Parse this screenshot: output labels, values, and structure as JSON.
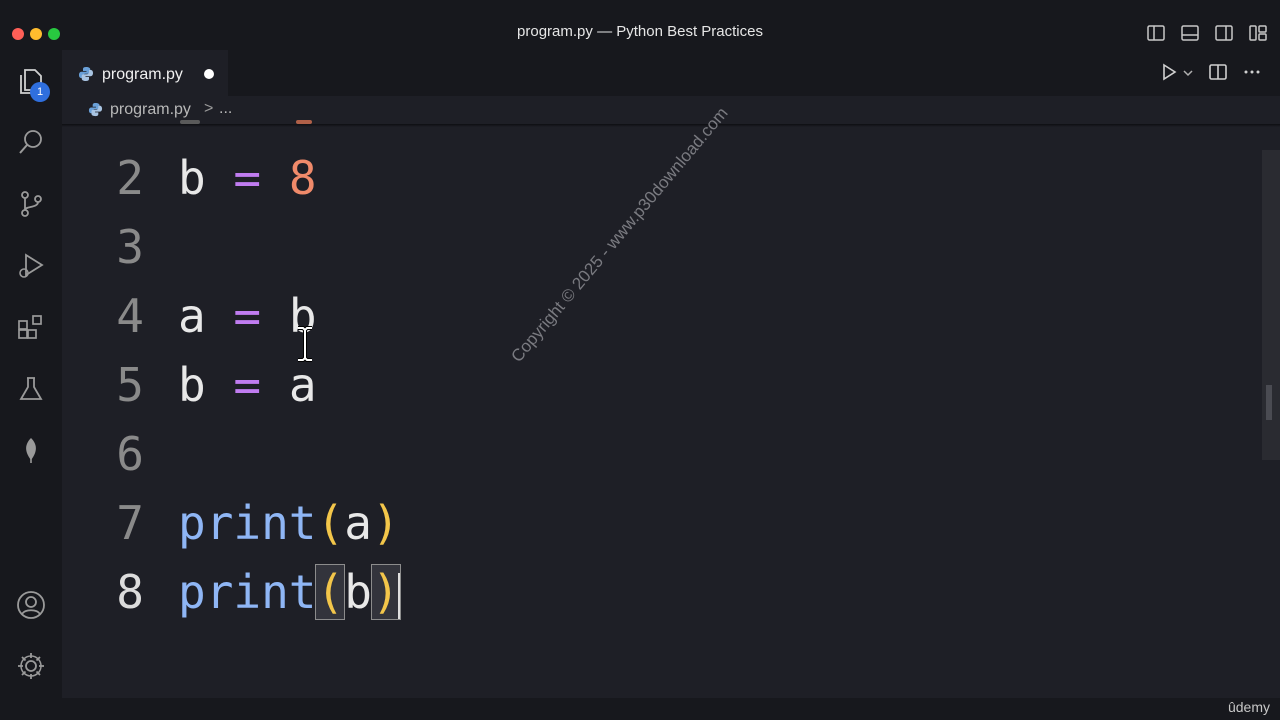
{
  "window": {
    "title": "program.py — Python Best Practices",
    "traffic_colors": [
      "#ff5f57",
      "#febc2e",
      "#28c840"
    ]
  },
  "activity_bar": {
    "explorer_badge": "1",
    "items": [
      "files-icon",
      "search-icon",
      "source-control-icon",
      "run-debug-icon",
      "extensions-icon",
      "testing-icon",
      "leaf-icon"
    ],
    "bottom_items": [
      "account-icon",
      "settings-gear-icon"
    ]
  },
  "tab": {
    "label": "program.py",
    "dirty": true
  },
  "breadcrumb": {
    "file": "program.py",
    "separator": ">",
    "more": "..."
  },
  "editor": {
    "lines": [
      {
        "n": "2",
        "tokens": [
          {
            "t": "b",
            "c": "var"
          },
          {
            "t": " ",
            "c": "sp"
          },
          {
            "t": "=",
            "c": "kw"
          },
          {
            "t": " ",
            "c": "sp"
          },
          {
            "t": "8",
            "c": "num"
          }
        ]
      },
      {
        "n": "3",
        "tokens": []
      },
      {
        "n": "4",
        "tokens": [
          {
            "t": "a",
            "c": "var"
          },
          {
            "t": " ",
            "c": "sp"
          },
          {
            "t": "=",
            "c": "kw"
          },
          {
            "t": " ",
            "c": "sp"
          },
          {
            "t": "b",
            "c": "var"
          }
        ]
      },
      {
        "n": "5",
        "tokens": [
          {
            "t": "b",
            "c": "var"
          },
          {
            "t": " ",
            "c": "sp"
          },
          {
            "t": "=",
            "c": "kw"
          },
          {
            "t": " ",
            "c": "sp"
          },
          {
            "t": "a",
            "c": "var"
          }
        ]
      },
      {
        "n": "6",
        "tokens": []
      },
      {
        "n": "7",
        "tokens": [
          {
            "t": "print",
            "c": "fn"
          },
          {
            "t": "(",
            "c": "paren"
          },
          {
            "t": "a",
            "c": "var"
          },
          {
            "t": ")",
            "c": "paren"
          }
        ]
      },
      {
        "n": "8",
        "tokens": [
          {
            "t": "print",
            "c": "fn"
          },
          {
            "t": "(",
            "c": "paren-box"
          },
          {
            "t": "b",
            "c": "var"
          },
          {
            "t": ")",
            "c": "paren-box"
          }
        ]
      }
    ],
    "active_line": "8",
    "colors": {
      "keyword": "#c07cf0",
      "number": "#f08a6a",
      "function": "#8fb6f5",
      "paren": "#f3c64a",
      "text": "#e8e8e8"
    }
  },
  "watermark": "Copyright © 2025 - www.p30download.com",
  "status": {
    "brand": "ûdemy"
  }
}
